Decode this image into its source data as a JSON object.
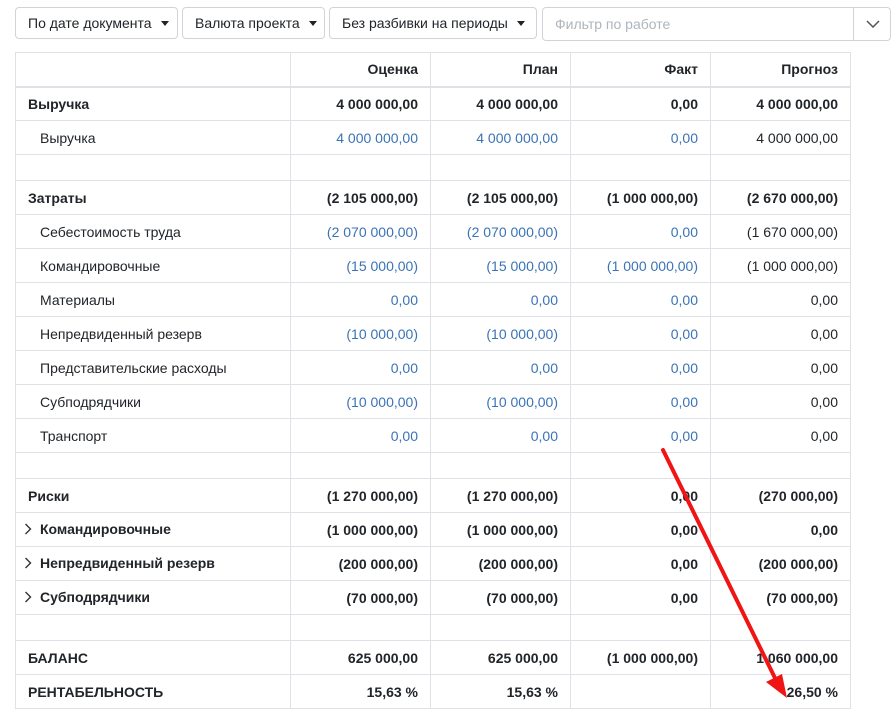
{
  "toolbar": {
    "date_mode": "По дате документа",
    "currency": "Валюта проекта",
    "period": "Без разбивки на периоды",
    "filter_placeholder": "Фильтр по работе"
  },
  "columns": [
    "Оценка",
    "План",
    "Факт",
    "Прогноз"
  ],
  "rows": {
    "revenue": {
      "label": "Выручка",
      "values": [
        "4 000 000,00",
        "4 000 000,00",
        "0,00",
        "4 000 000,00"
      ]
    },
    "revenue_item": {
      "label": "Выручка",
      "values": [
        "4 000 000,00",
        "4 000 000,00",
        "0,00",
        "4 000 000,00"
      ]
    },
    "costs": {
      "label": "Затраты",
      "values": [
        "(2 105 000,00)",
        "(2 105 000,00)",
        "(1 000 000,00)",
        "(2 670 000,00)"
      ]
    },
    "labor": {
      "label": "Себестоимость труда",
      "values": [
        "(2 070 000,00)",
        "(2 070 000,00)",
        "0,00",
        "(1 670 000,00)"
      ]
    },
    "travel": {
      "label": "Командировочные",
      "values": [
        "(15 000,00)",
        "(15 000,00)",
        "(1 000 000,00)",
        "(1 000 000,00)"
      ]
    },
    "materials": {
      "label": "Материалы",
      "values": [
        "0,00",
        "0,00",
        "0,00",
        "0,00"
      ]
    },
    "reserve": {
      "label": "Непредвиденный резерв",
      "values": [
        "(10 000,00)",
        "(10 000,00)",
        "0,00",
        "0,00"
      ]
    },
    "entertainment": {
      "label": "Представительские расходы",
      "values": [
        "0,00",
        "0,00",
        "0,00",
        "0,00"
      ]
    },
    "subcontractors": {
      "label": "Субподрядчики",
      "values": [
        "(10 000,00)",
        "(10 000,00)",
        "0,00",
        "0,00"
      ]
    },
    "transport": {
      "label": "Транспорт",
      "values": [
        "0,00",
        "0,00",
        "0,00",
        "0,00"
      ]
    },
    "risks": {
      "label": "Риски",
      "values": [
        "(1 270 000,00)",
        "(1 270 000,00)",
        "0,00",
        "(270 000,00)"
      ]
    },
    "risk_travel": {
      "label": "Командировочные",
      "values": [
        "(1 000 000,00)",
        "(1 000 000,00)",
        "0,00",
        "0,00"
      ]
    },
    "risk_reserve": {
      "label": "Непредвиденный резерв",
      "values": [
        "(200 000,00)",
        "(200 000,00)",
        "0,00",
        "(200 000,00)"
      ]
    },
    "risk_sub": {
      "label": "Субподрядчики",
      "values": [
        "(70 000,00)",
        "(70 000,00)",
        "0,00",
        "(70 000,00)"
      ]
    },
    "balance": {
      "label": "БАЛАНС",
      "values": [
        "625 000,00",
        "625 000,00",
        "(1 000 000,00)",
        "1 060 000,00"
      ]
    },
    "profitability": {
      "label": "РЕНТАБЕЛЬНОСТЬ",
      "values": [
        "15,63 %",
        "15,63 %",
        "",
        "26,50 %"
      ]
    }
  },
  "annotation": {
    "arrow_color": "#f01414"
  },
  "icons": {
    "expand": "chevron-right-icon",
    "caret": "caret-down-icon",
    "dropdown": "chevron-down-icon"
  }
}
